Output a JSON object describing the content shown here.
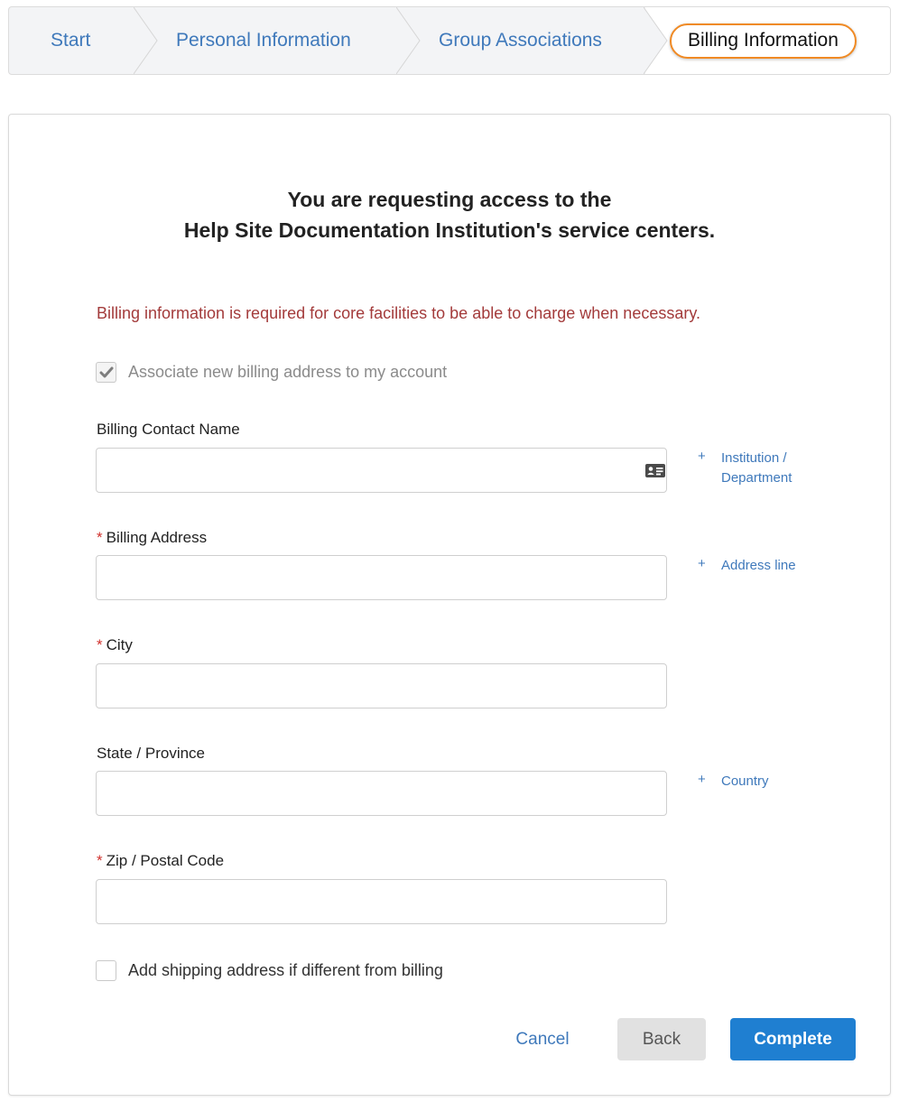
{
  "stepper": {
    "steps": [
      {
        "label": "Start"
      },
      {
        "label": "Personal Information"
      },
      {
        "label": "Group Associations"
      },
      {
        "label": "Billing Information",
        "active": true
      }
    ]
  },
  "heading": {
    "line1": "You are requesting access to the",
    "line2": "Help Site Documentation Institution's service centers."
  },
  "notice": "Billing information is required for core facilities to be able to charge when necessary.",
  "associate_checkbox": {
    "label": "Associate new billing address to my account",
    "checked": true
  },
  "fields": {
    "contact_name": {
      "label": "Billing Contact Name",
      "value": ""
    },
    "address": {
      "label": "Billing Address",
      "required": "*",
      "value": ""
    },
    "city": {
      "label": "City",
      "required": "*",
      "value": ""
    },
    "state": {
      "label": "State / Province",
      "value": ""
    },
    "zip": {
      "label": "Zip / Postal Code",
      "required": "*",
      "value": ""
    }
  },
  "links": {
    "plus": "+",
    "institution_line1": "Institution /",
    "institution_line2": "Department",
    "address_line": "Address line",
    "country": "Country"
  },
  "shipping_checkbox": {
    "label": "Add shipping address if different from billing",
    "checked": false
  },
  "buttons": {
    "cancel": "Cancel",
    "back": "Back",
    "complete": "Complete"
  },
  "colors": {
    "accent": "#1f7fd1",
    "link": "#3f79bb",
    "notice": "#a33b3b",
    "active_step_outline": "#f08a24",
    "required": "#d0312d"
  },
  "icons": {
    "contact_card": "contact-card-icon",
    "check": "check-icon"
  }
}
